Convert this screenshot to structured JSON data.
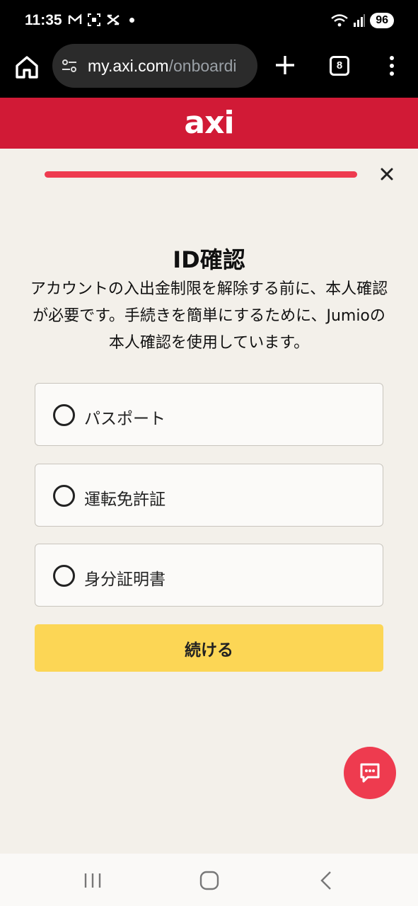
{
  "status_bar": {
    "time": "11:35",
    "battery": "96"
  },
  "browser": {
    "url_host": "my.axi.com",
    "url_path": "/onboardi",
    "tab_count": "8"
  },
  "header": {
    "logo_text": "axi"
  },
  "progress": {
    "value": 1.0
  },
  "content": {
    "title": "ID確認",
    "description": "アカウントの入出金制限を解除する前に、本人確認が必要です。手続きを簡単にするために、Jumioの本人確認を使用しています。",
    "options": [
      {
        "label": "パスポート"
      },
      {
        "label": "運転免許証"
      },
      {
        "label": "身分証明書"
      }
    ],
    "continue_label": "続ける"
  },
  "colors": {
    "brand_red": "#d11a36",
    "accent_red": "#ee3b4f",
    "button_yellow": "#fcd655"
  }
}
